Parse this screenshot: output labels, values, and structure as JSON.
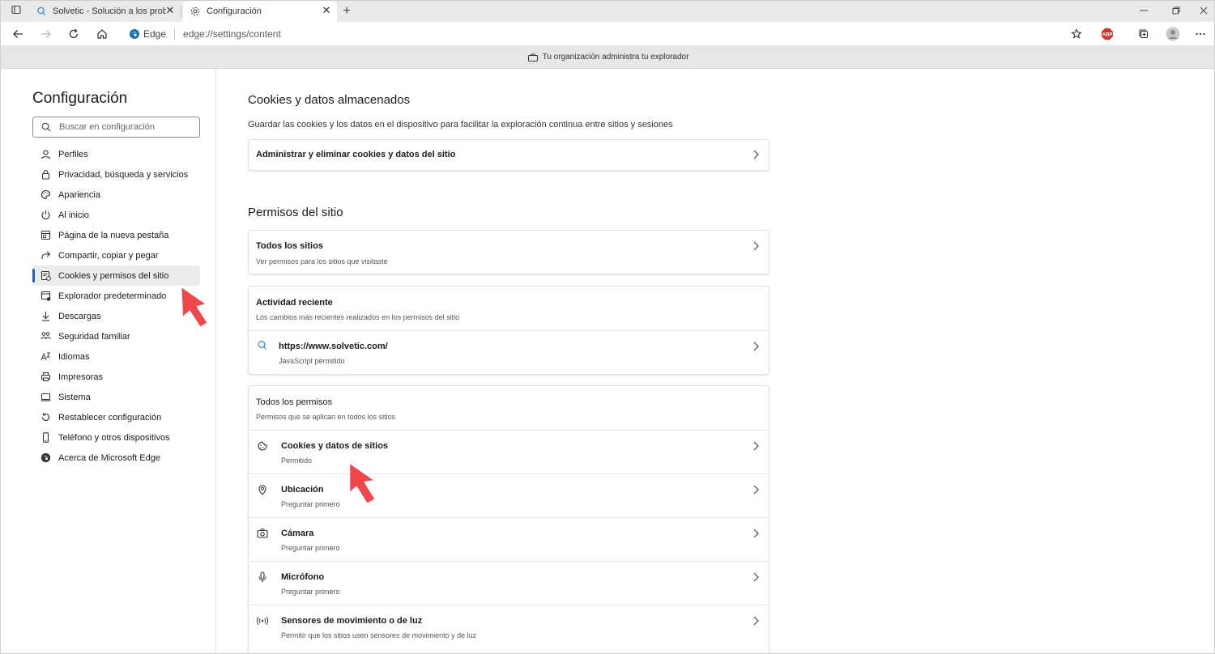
{
  "tabs": [
    {
      "title": "Solvetic - Solución a los problem",
      "icon": "solvetic-icon"
    },
    {
      "title": "Configuración",
      "icon": "gear-icon"
    }
  ],
  "address": {
    "brand": "Edge",
    "url": "edge://settings/content"
  },
  "banner": {
    "text": "Tu organización administra tu explorador"
  },
  "sidebar": {
    "title": "Configuración",
    "search_placeholder": "Buscar en configuración",
    "items": [
      {
        "label": "Perfiles",
        "icon": "profile-icon"
      },
      {
        "label": "Privacidad, búsqueda y servicios",
        "icon": "lock-icon"
      },
      {
        "label": "Apariencia",
        "icon": "palette-icon"
      },
      {
        "label": "Al inicio",
        "icon": "power-icon"
      },
      {
        "label": "Página de la nueva pestaña",
        "icon": "new-tab-icon"
      },
      {
        "label": "Compartir, copiar y pegar",
        "icon": "share-icon"
      },
      {
        "label": "Cookies y permisos del sitio",
        "icon": "cookies-permissions-icon",
        "active": true
      },
      {
        "label": "Explorador predeterminado",
        "icon": "default-browser-icon"
      },
      {
        "label": "Descargas",
        "icon": "download-icon"
      },
      {
        "label": "Seguridad familiar",
        "icon": "family-icon"
      },
      {
        "label": "Idiomas",
        "icon": "language-icon"
      },
      {
        "label": "Impresoras",
        "icon": "printer-icon"
      },
      {
        "label": "Sistema",
        "icon": "system-icon"
      },
      {
        "label": "Restablecer configuración",
        "icon": "reset-icon"
      },
      {
        "label": "Teléfono y otros dispositivos",
        "icon": "phone-icon"
      },
      {
        "label": "Acerca de Microsoft Edge",
        "icon": "edge-logo-icon"
      }
    ]
  },
  "main": {
    "cookies_section": {
      "title": "Cookies y datos almacenados",
      "description": "Guardar las cookies y los datos en el dispositivo para facilitar la exploración continua entre sitios y sesiones",
      "manage_label": "Administrar y eliminar cookies y datos del sitio"
    },
    "permissions_section": {
      "title": "Permisos del sitio",
      "all_sites": {
        "title": "Todos los sitios",
        "subtitle": "Ver permisos para los sitios que visitaste"
      },
      "recent_activity": {
        "title": "Actividad reciente",
        "subtitle": "Los cambios más recientes realizados en los permisos del sitio",
        "site": {
          "title": "https://www.solvetic.com/",
          "subtitle": "JavaScript permitido"
        }
      },
      "all_permissions": {
        "title": "Todos los permisos",
        "subtitle": "Permisos que se aplican en todos los sitios",
        "items": [
          {
            "title": "Cookies y datos de sitios",
            "subtitle": "Permitido",
            "icon": "cookie-icon"
          },
          {
            "title": "Ubicación",
            "subtitle": "Preguntar primero",
            "icon": "location-icon"
          },
          {
            "title": "Cámara",
            "subtitle": "Preguntar primero",
            "icon": "camera-icon"
          },
          {
            "title": "Micrófono",
            "subtitle": "Preguntar primero",
            "icon": "microphone-icon"
          },
          {
            "title": "Sensores de movimiento o de luz",
            "subtitle": "Permitir que los sitios usen sensores de movimiento y de luz",
            "icon": "sensor-icon"
          }
        ]
      }
    }
  },
  "colors": {
    "active_indicator": "#2b5fa6",
    "annotation_arrow": "#f2474a",
    "abp_badge": "#d9302a"
  }
}
